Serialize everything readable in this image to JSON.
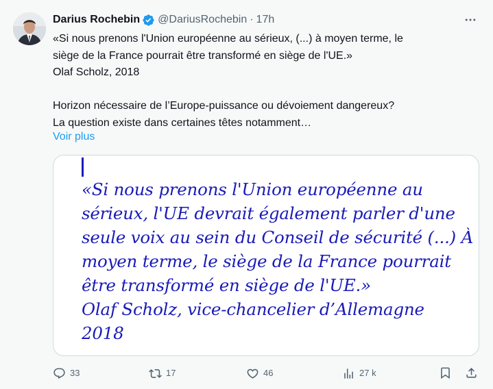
{
  "author": {
    "display_name": "Darius Rochebin",
    "handle": "@DariusRochebin",
    "separator": "·",
    "time": "17h",
    "verified": true
  },
  "text": {
    "lines": [
      "«Si nous prenons l'Union européenne au sérieux, (...) à moyen terme, le",
      "siège de la France pourrait être transformé en siège de l'UE.»",
      "Olaf Scholz, 2018",
      "",
      "Horizon nécessaire de l’Europe-puissance ou dévoiement dangereux?",
      "La question existe dans certaines têtes notamment…"
    ],
    "show_more": "Voir plus"
  },
  "media": {
    "quote_lines": [
      "«Si nous prenons l'Union européenne au",
      "sérieux, l'UE devrait également parler d'une",
      "seule voix au sein du Conseil de sécurité (...) À",
      "moyen terme, le siège de la France pourrait",
      "être transformé en siège de l'UE.»",
      "Olaf Scholz, vice-chancelier d’Allemagne",
      "2018"
    ],
    "quote_color": "#1a1ab8"
  },
  "actions": {
    "reply_count": "33",
    "retweet_count": "17",
    "like_count": "46",
    "views_count": "27 k"
  },
  "icons": {
    "more": "more-horizontal-icon",
    "verified": "verified-badge-icon",
    "reply": "reply-icon",
    "retweet": "retweet-icon",
    "like": "heart-icon",
    "views": "analytics-icon",
    "bookmark": "bookmark-icon",
    "share": "share-icon"
  },
  "colors": {
    "background": "#f7f9f9",
    "text": "#0f1419",
    "secondary": "#536471",
    "link": "#1d9bf0",
    "verified": "#1d9bf0"
  }
}
